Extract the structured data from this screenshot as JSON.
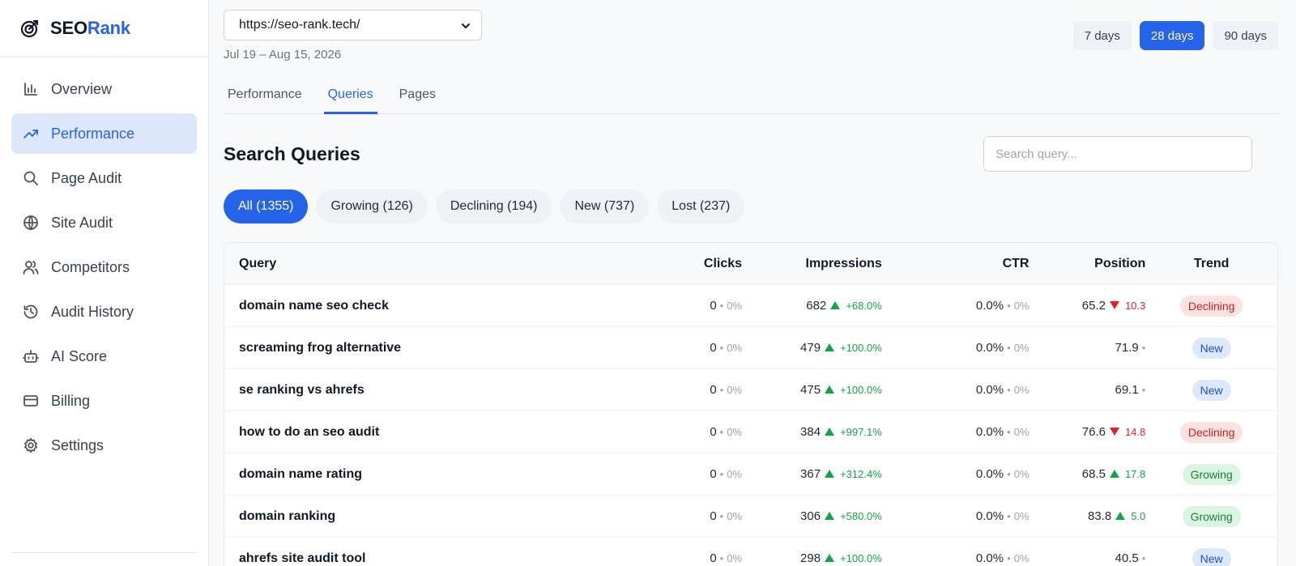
{
  "brand": {
    "part1": "SEO",
    "part2": "Rank"
  },
  "sidebar": {
    "items": [
      {
        "label": "Overview",
        "icon": "bar-chart-icon"
      },
      {
        "label": "Performance",
        "icon": "trending-up-icon",
        "active": true
      },
      {
        "label": "Page Audit",
        "icon": "search-icon"
      },
      {
        "label": "Site Audit",
        "icon": "globe-icon"
      },
      {
        "label": "Competitors",
        "icon": "users-icon"
      },
      {
        "label": "Audit History",
        "icon": "history-icon"
      },
      {
        "label": "AI Score",
        "icon": "bot-icon"
      },
      {
        "label": "Billing",
        "icon": "credit-card-icon"
      },
      {
        "label": "Settings",
        "icon": "gear-icon"
      }
    ]
  },
  "header": {
    "site": "https://seo-rank.tech/",
    "date_range": "Jul 19 – Aug 15, 2026",
    "periods": [
      "7 days",
      "28 days",
      "90 days"
    ],
    "active_period": "28 days"
  },
  "tabs": [
    "Performance",
    "Queries",
    "Pages"
  ],
  "active_tab": "Queries",
  "section": {
    "title": "Search Queries",
    "search_placeholder": "Search query..."
  },
  "filters": [
    "All (1355)",
    "Growing (126)",
    "Declining (194)",
    "New (737)",
    "Lost (237)"
  ],
  "table": {
    "columns": [
      "Query",
      "Clicks",
      "Impressions",
      "CTR",
      "Position",
      "Trend"
    ],
    "rows": [
      {
        "query": "domain name seo check",
        "clicks": "0",
        "clicks_delta": "0%",
        "impressions": "682",
        "impressions_delta": "+68.0%",
        "ctr": "0.0%",
        "ctr_delta": "0%",
        "position": "65.2",
        "position_delta": "10.3",
        "position_dir": "down",
        "trend": "Declining"
      },
      {
        "query": "screaming frog alternative",
        "clicks": "0",
        "clicks_delta": "0%",
        "impressions": "479",
        "impressions_delta": "+100.0%",
        "ctr": "0.0%",
        "ctr_delta": "0%",
        "position": "71.9",
        "position_delta": "",
        "position_dir": "none",
        "trend": "New"
      },
      {
        "query": "se ranking vs ahrefs",
        "clicks": "0",
        "clicks_delta": "0%",
        "impressions": "475",
        "impressions_delta": "+100.0%",
        "ctr": "0.0%",
        "ctr_delta": "0%",
        "position": "69.1",
        "position_delta": "",
        "position_dir": "none",
        "trend": "New"
      },
      {
        "query": "how to do an seo audit",
        "clicks": "0",
        "clicks_delta": "0%",
        "impressions": "384",
        "impressions_delta": "+997.1%",
        "ctr": "0.0%",
        "ctr_delta": "0%",
        "position": "76.6",
        "position_delta": "14.8",
        "position_dir": "down",
        "trend": "Declining"
      },
      {
        "query": "domain name rating",
        "clicks": "0",
        "clicks_delta": "0%",
        "impressions": "367",
        "impressions_delta": "+312.4%",
        "ctr": "0.0%",
        "ctr_delta": "0%",
        "position": "68.5",
        "position_delta": "17.8",
        "position_dir": "up",
        "trend": "Growing"
      },
      {
        "query": "domain ranking",
        "clicks": "0",
        "clicks_delta": "0%",
        "impressions": "306",
        "impressions_delta": "+580.0%",
        "ctr": "0.0%",
        "ctr_delta": "0%",
        "position": "83.8",
        "position_delta": "5.0",
        "position_dir": "up",
        "trend": "Growing"
      },
      {
        "query": "ahrefs site audit tool",
        "clicks": "0",
        "clicks_delta": "0%",
        "impressions": "298",
        "impressions_delta": "+100.0%",
        "ctr": "0.0%",
        "ctr_delta": "0%",
        "position": "40.5",
        "position_delta": "",
        "position_dir": "none",
        "trend": "New"
      }
    ]
  },
  "colors": {
    "accent": "#2563eb",
    "up": "#16a34a",
    "down": "#dc2626"
  }
}
